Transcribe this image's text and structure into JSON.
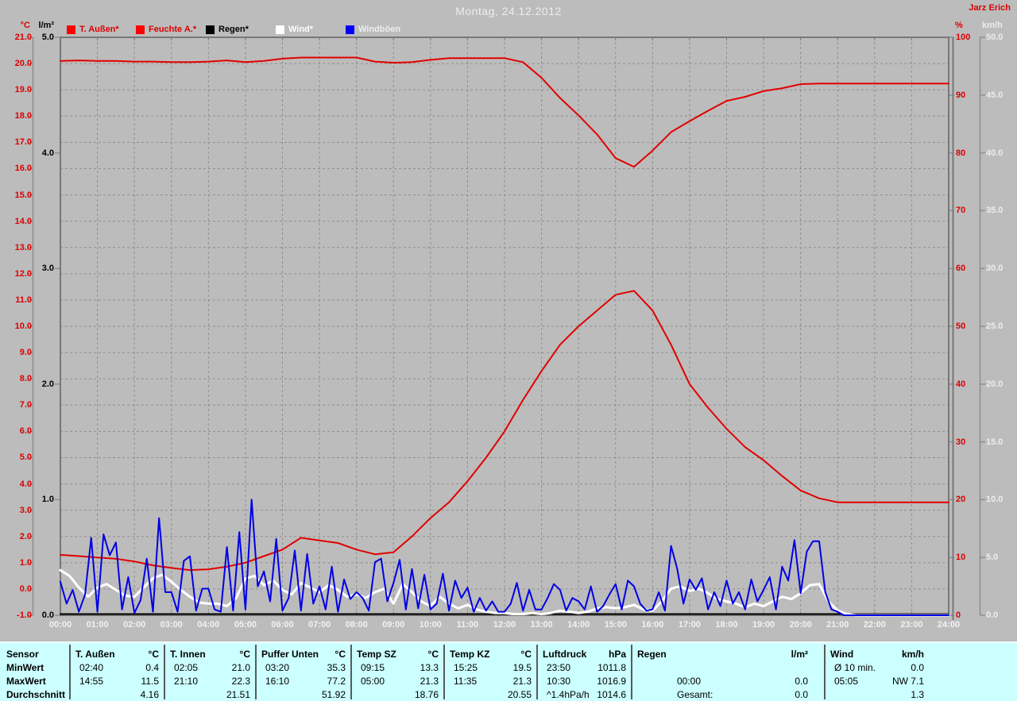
{
  "header": {
    "title": "Montag, 24.12.2012",
    "operator": "Jarz Erich"
  },
  "legend": {
    "items": [
      {
        "label": "T. Außen*",
        "swatch": "#ff0000",
        "text": "#dd0000"
      },
      {
        "label": "Feuchte A.*",
        "swatch": "#ff0000",
        "text": "#dd0000"
      },
      {
        "label": "Regen*",
        "swatch": "#000000",
        "text": "#000000"
      },
      {
        "label": "Wind*",
        "swatch": "#ffffff",
        "text": "#ffffff"
      },
      {
        "label": "Windböen",
        "swatch": "#0000ff",
        "text": "#eeeeee"
      }
    ]
  },
  "colors": {
    "background": "#bcbcbc",
    "plot_border": "#787878",
    "grid": "#8e8e8e",
    "red": "#e10000",
    "blue": "#0000e6",
    "white": "#ffffff",
    "black": "#000000",
    "table_background": "#ccffff",
    "title_text": "#ededed"
  },
  "chart_data": {
    "type": "line",
    "title": "Montag, 24.12.2012",
    "grid": {
      "horizontal_step_c": 1.0,
      "vertical_step_hours": 1,
      "style": "dashed"
    },
    "legend_position": "top",
    "x_axis": {
      "start_hour": 0,
      "end_hour": 24,
      "tick_labels": [
        "00:00",
        "01:00",
        "02:00",
        "03:00",
        "04:00",
        "05:00",
        "06:00",
        "07:00",
        "08:00",
        "09:00",
        "10:00",
        "11:00",
        "12:00",
        "13:00",
        "14:00",
        "15:00",
        "16:00",
        "17:00",
        "18:00",
        "19:00",
        "20:00",
        "21:00",
        "22:00",
        "23:00",
        "24:00"
      ]
    },
    "y_axes": [
      {
        "id": "temp",
        "unit": "°C",
        "side": "far-left",
        "min": -1.0,
        "max": 21.0,
        "tick_step": 1.0,
        "tick_labels": [
          "21.0",
          "20.0",
          "19.0",
          "18.0",
          "17.0",
          "16.0",
          "15.0",
          "14.0",
          "13.0",
          "12.0",
          "11.0",
          "10.0",
          "9.0",
          "8.0",
          "7.0",
          "6.0",
          "5.0",
          "4.0",
          "3.0",
          "2.0",
          "1.0",
          "0.0",
          "-1.0"
        ]
      },
      {
        "id": "rain",
        "unit": "l/m²",
        "side": "left",
        "min": 0.0,
        "max": 5.0,
        "tick_step": 1.0,
        "tick_labels": [
          "5.0",
          "4.0",
          "3.0",
          "2.0",
          "1.0",
          "0.0"
        ]
      },
      {
        "id": "humidity",
        "unit": "%",
        "side": "right",
        "min": 0,
        "max": 100,
        "tick_step": 10,
        "tick_labels": [
          "100",
          "90",
          "80",
          "70",
          "60",
          "50",
          "40",
          "30",
          "20",
          "10",
          "0"
        ]
      },
      {
        "id": "wind",
        "unit": "km/h",
        "side": "far-right",
        "min": 0.0,
        "max": 50.0,
        "tick_step": 5.0,
        "tick_labels": [
          "50.0",
          "45.0",
          "40.0",
          "35.0",
          "30.0",
          "25.0",
          "20.0",
          "15.0",
          "10.0",
          "5.0",
          "0.0"
        ]
      }
    ],
    "series": [
      {
        "name": "T. Außen*",
        "axis": "temp",
        "color": "#e10000",
        "width": 2,
        "step_hours": 0.5,
        "values": [
          1.3,
          1.25,
          1.2,
          1.15,
          1.05,
          0.9,
          0.8,
          0.72,
          0.75,
          0.85,
          1.0,
          1.25,
          1.5,
          1.95,
          1.85,
          1.75,
          1.5,
          1.32,
          1.4,
          2.0,
          2.7,
          3.3,
          4.1,
          5.0,
          6.0,
          7.2,
          8.3,
          9.3,
          10.0,
          10.6,
          11.2,
          11.35,
          10.6,
          9.3,
          7.8,
          6.9,
          6.1,
          5.4,
          4.9,
          4.3,
          3.75,
          3.45,
          3.3,
          3.3,
          3.3,
          3.3,
          3.3,
          3.3,
          3.3
        ]
      },
      {
        "name": "Feuchte A.*",
        "axis": "humidity",
        "color": "#e10000",
        "width": 2,
        "step_hours": 0.5,
        "values": [
          95.9,
          96.0,
          95.9,
          95.9,
          95.8,
          95.8,
          95.7,
          95.7,
          95.8,
          96.0,
          95.7,
          95.9,
          96.3,
          96.5,
          96.5,
          96.5,
          96.5,
          95.8,
          95.6,
          95.7,
          96.1,
          96.4,
          96.4,
          96.4,
          96.4,
          95.7,
          93.0,
          89.5,
          86.5,
          83.2,
          79.1,
          77.6,
          80.4,
          83.6,
          85.5,
          87.3,
          89.0,
          89.7,
          90.7,
          91.2,
          91.9,
          92.0,
          92.0,
          92.0,
          92.0,
          92.0,
          92.0,
          92.0,
          92.0
        ]
      },
      {
        "name": "Regen*",
        "axis": "rain",
        "color": "#000000",
        "width": 2,
        "step_hours": 12,
        "values": [
          0,
          0,
          0
        ]
      },
      {
        "name": "Wind*",
        "axis": "wind",
        "color": "#ffffff",
        "width": 3,
        "step_hours": 0.25,
        "values": [
          3.9,
          3.4,
          2.4,
          1.6,
          2.4,
          2.7,
          2.2,
          1.7,
          1.6,
          2.4,
          3.2,
          3.5,
          2.9,
          2.2,
          1.6,
          1.1,
          1.0,
          1.0,
          0.8,
          1.5,
          3.2,
          3.4,
          2.6,
          3.0,
          2.2,
          1.8,
          2.8,
          2.4,
          2.0,
          2.6,
          2.2,
          1.6,
          1.8,
          1.5,
          2.0,
          2.3,
          1.0,
          2.7,
          2.0,
          1.2,
          0.8,
          1.6,
          1.0,
          0.6,
          0.9,
          0.5,
          0.3,
          0.2,
          0.2,
          0.1,
          0.1,
          0.2,
          0.1,
          0.2,
          0.4,
          0.3,
          0.2,
          0.3,
          0.6,
          0.7,
          0.6,
          0.7,
          0.9,
          0.5,
          0.4,
          1.2,
          2.3,
          2.5,
          2.1,
          2.3,
          1.9,
          1.4,
          1.2,
          1.0,
          0.7,
          1.0,
          0.8,
          1.2,
          1.6,
          1.4,
          1.9,
          2.6,
          2.7,
          1.2,
          0.4,
          0.1,
          0,
          0,
          0,
          0,
          0,
          0,
          0,
          0,
          0,
          0,
          0
        ]
      },
      {
        "name": "Windböen",
        "axis": "wind",
        "color": "#0000e6",
        "width": 2,
        "step_hours": 0.166667,
        "values": [
          2.9,
          1.0,
          2.2,
          0.3,
          1.8,
          6.7,
          0.3,
          7.0,
          5.2,
          6.3,
          0.5,
          3.3,
          0.2,
          1.3,
          4.9,
          0.3,
          8.4,
          2.0,
          2.0,
          0.3,
          4.7,
          5.1,
          0.4,
          2.3,
          2.3,
          0.5,
          0.3,
          5.9,
          0.4,
          7.2,
          0.5,
          10.0,
          2.5,
          3.8,
          1.2,
          6.6,
          0.4,
          1.5,
          5.6,
          0.4,
          5.3,
          1.0,
          2.5,
          0.5,
          4.2,
          0.3,
          3.1,
          1.4,
          2.0,
          1.5,
          0.4,
          4.6,
          4.9,
          1.2,
          2.8,
          4.8,
          0.5,
          4.0,
          0.6,
          3.5,
          0.5,
          1.0,
          3.6,
          0.4,
          3.0,
          1.5,
          2.4,
          0.3,
          1.5,
          0.4,
          1.2,
          0.3,
          0.3,
          1.0,
          2.8,
          0.4,
          2.2,
          0.5,
          0.5,
          1.5,
          2.7,
          2.2,
          0.4,
          1.5,
          1.2,
          0.5,
          2.5,
          0.3,
          0.8,
          1.8,
          2.7,
          0.5,
          3.0,
          2.5,
          1.0,
          0.4,
          0.5,
          2.0,
          0.4,
          6.0,
          4.0,
          1.0,
          3.1,
          2.2,
          3.2,
          0.5,
          2.0,
          0.8,
          3.0,
          1.0,
          2.0,
          0.5,
          3.1,
          1.2,
          2.2,
          3.3,
          0.5,
          4.2,
          3.0,
          6.5,
          1.9,
          5.5,
          6.4,
          6.4,
          2.0,
          0.5,
          0.3,
          0,
          0,
          0,
          0,
          0,
          0,
          0,
          0,
          0,
          0,
          0,
          0,
          0,
          0,
          0,
          0,
          0,
          0
        ]
      }
    ]
  },
  "table": {
    "row_labels": [
      "Sensor",
      "MinWert",
      "MaxWert",
      "Durchschnitt"
    ],
    "columns": [
      {
        "name": "T. Außen",
        "unit": "°C",
        "min": [
          "02:40",
          "0.4"
        ],
        "max": [
          "14:55",
          "11.5"
        ],
        "avg": [
          "",
          "4.16"
        ]
      },
      {
        "name": "T. Innen",
        "unit": "°C",
        "min": [
          "02:05",
          "21.0"
        ],
        "max": [
          "21:10",
          "22.3"
        ],
        "avg": [
          "",
          "21.51"
        ]
      },
      {
        "name": "Puffer Unten",
        "unit": "°C",
        "min": [
          "03:20",
          "35.3"
        ],
        "max": [
          "16:10",
          "77.2"
        ],
        "avg": [
          "",
          "51.92"
        ]
      },
      {
        "name": "Temp SZ",
        "unit": "°C",
        "min": [
          "09:15",
          "13.3"
        ],
        "max": [
          "05:00",
          "21.3"
        ],
        "avg": [
          "",
          "18.76"
        ]
      },
      {
        "name": "Temp KZ",
        "unit": "°C",
        "min": [
          "15:25",
          "19.5"
        ],
        "max": [
          "11:35",
          "21.3"
        ],
        "avg": [
          "",
          "20.55"
        ]
      },
      {
        "name": "Luftdruck",
        "unit": "hPa",
        "min": [
          "23:50",
          "1011.8"
        ],
        "max": [
          "10:30",
          "1016.9"
        ],
        "avg": [
          "^1.4hPa/h",
          "1014.6"
        ]
      },
      {
        "name": "Regen",
        "unit": "l/m²",
        "min": [
          "",
          ""
        ],
        "max": [
          "00:00",
          "0.0"
        ],
        "avg": [
          "Gesamt:",
          "0.0"
        ]
      },
      {
        "name": "Wind",
        "unit": "km/h",
        "min": [
          "Ø 10 min.",
          "0.0"
        ],
        "max": [
          "05:05",
          "NW 7.1"
        ],
        "avg": [
          "",
          "1.3"
        ]
      }
    ]
  }
}
